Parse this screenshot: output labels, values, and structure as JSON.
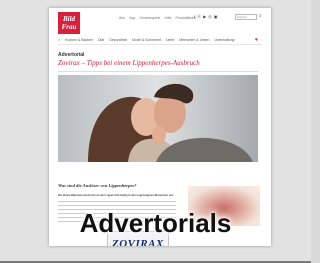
{
  "logo": {
    "text_line1": "Bild",
    "text_line2": "Frau",
    "color": "#d8203a"
  },
  "top_nav": [
    "Abo",
    "App",
    "Gewinnspiele",
    "Hilfe",
    "Produktfinder"
  ],
  "social_icons": [
    "facebook-icon",
    "pinterest-icon",
    "youtube-icon",
    "instagram-icon",
    "rss-icon"
  ],
  "search": {
    "placeholder": "Suchen"
  },
  "category_nav": [
    "Kochen & Backen",
    "Diät",
    "Gesundheit",
    "Mode & Schönheit",
    "Liebe",
    "Menschen & Leben",
    "Unterhaltung"
  ],
  "article": {
    "label": "Advertorial",
    "headline": "Zovirax – Tipps bei einem Lippenherpes-Ausbruch",
    "subhead": "Was sind die Auslöser von Lippenherpes?",
    "lead_text": "Der kleine Bläschen-Ausbruch an den Lippen tritt häufig in den ungünstigsten Momenten auf.",
    "product_name": "ZOVIRAX",
    "accent_color": "#c8203a"
  },
  "overlay_label": "Advertorials"
}
